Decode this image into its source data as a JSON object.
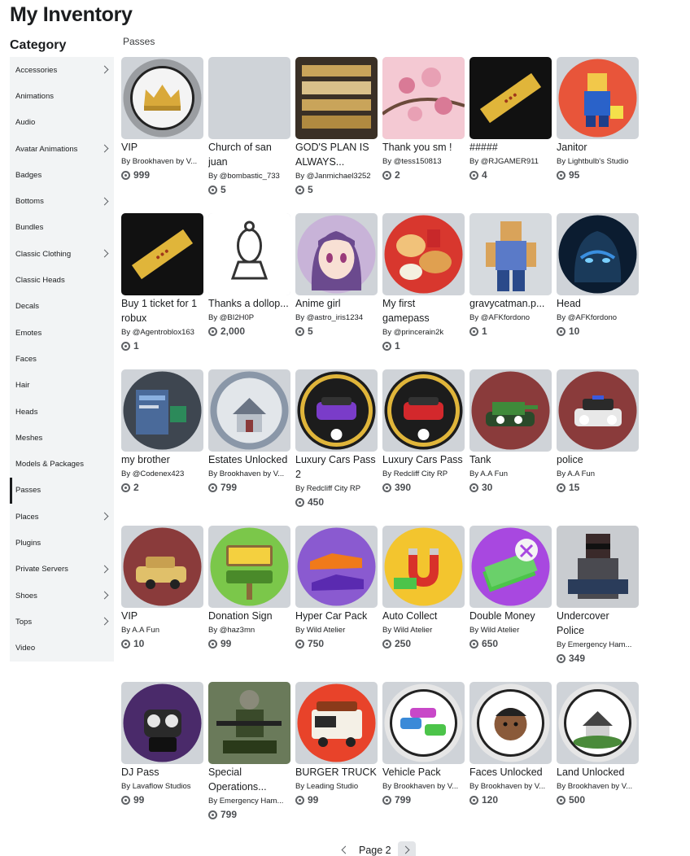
{
  "page": {
    "title": "My Inventory",
    "category_title": "Category",
    "section_label": "Passes"
  },
  "categories": [
    {
      "label": "Accessories",
      "chevron": true
    },
    {
      "label": "Animations",
      "chevron": false
    },
    {
      "label": "Audio",
      "chevron": false
    },
    {
      "label": "Avatar Animations",
      "chevron": true
    },
    {
      "label": "Badges",
      "chevron": false
    },
    {
      "label": "Bottoms",
      "chevron": true
    },
    {
      "label": "Bundles",
      "chevron": false
    },
    {
      "label": "Classic Clothing",
      "chevron": true
    },
    {
      "label": "Classic Heads",
      "chevron": false
    },
    {
      "label": "Decals",
      "chevron": false
    },
    {
      "label": "Emotes",
      "chevron": false
    },
    {
      "label": "Faces",
      "chevron": false
    },
    {
      "label": "Hair",
      "chevron": false
    },
    {
      "label": "Heads",
      "chevron": false
    },
    {
      "label": "Meshes",
      "chevron": false
    },
    {
      "label": "Models & Packages",
      "chevron": false
    },
    {
      "label": "Passes",
      "chevron": false,
      "active": true
    },
    {
      "label": "Places",
      "chevron": true
    },
    {
      "label": "Plugins",
      "chevron": false
    },
    {
      "label": "Private Servers",
      "chevron": true
    },
    {
      "label": "Shoes",
      "chevron": true
    },
    {
      "label": "Tops",
      "chevron": true
    },
    {
      "label": "Video",
      "chevron": false
    }
  ],
  "items": [
    {
      "name": "VIP",
      "creator": "By Brookhaven by V...",
      "price": "999",
      "thumb": "crown-icon",
      "bg": "#9a9da1",
      "fg": "#d9a93a"
    },
    {
      "name": "Church of san juan",
      "creator": "By @bombastic_733",
      "price": "5",
      "thumb": "blank",
      "bg": "#d0d4d9",
      "fg": "#d0d4d9"
    },
    {
      "name": "GOD'S PLAN IS ALWAYS...",
      "creator": "By @Janmichael3252",
      "price": "5",
      "thumb": "text-art-icon",
      "bg": "#3a3026",
      "fg": "#c9a45a"
    },
    {
      "name": "Thank you sm !",
      "creator": "By @tess150813",
      "price": "2",
      "thumb": "blossom-icon",
      "bg": "#f4c9d3",
      "fg": "#d97a96"
    },
    {
      "name": "#####",
      "creator": "By @RJGAMER911",
      "price": "4",
      "thumb": "ticket-icon",
      "bg": "#111111",
      "fg": "#e0b53a"
    },
    {
      "name": "Janitor",
      "creator": "By Lightbulb's Studio",
      "price": "95",
      "thumb": "janitor-icon",
      "bg": "#e8553a",
      "fg": "#2a62c9"
    },
    {
      "name": "Buy 1 ticket for 1 robux",
      "creator": "By @Agentroblox163",
      "price": "1",
      "thumb": "ticket-icon",
      "bg": "#111111",
      "fg": "#e0b53a"
    },
    {
      "name": "Thanks a dollop...",
      "creator": "By @BI2H0P",
      "price": "2,000",
      "thumb": "bishop-icon",
      "bg": "#f4f4f4",
      "fg": "#333333"
    },
    {
      "name": "Anime girl",
      "creator": "By @astro_iris1234",
      "price": "5",
      "thumb": "anime-icon",
      "bg": "#c8b3d8",
      "fg": "#6b4a8e"
    },
    {
      "name": "My first gamepass",
      "creator": "By @princerain2k",
      "price": "1",
      "thumb": "food-icon",
      "bg": "#d8372e",
      "fg": "#f1c27a"
    },
    {
      "name": "gravycatman.p...",
      "creator": "By @AFKfordono",
      "price": "1",
      "thumb": "avatar-icon",
      "bg": "#d6dade",
      "fg": "#d9a35a"
    },
    {
      "name": "Head",
      "creator": "By @AFKfordono",
      "price": "10",
      "thumb": "head-icon",
      "bg": "#0b1c30",
      "fg": "#3a8fe0"
    },
    {
      "name": "my brother",
      "creator": "By @Codenex423",
      "price": "2",
      "thumb": "screenshot-icon",
      "bg": "#3e4650",
      "fg": "#2c8a5a"
    },
    {
      "name": "Estates Unlocked",
      "creator": "By Brookhaven by V...",
      "price": "799",
      "thumb": "house-icon",
      "bg": "#8a97a8",
      "fg": "#e2e6ea"
    },
    {
      "name": "Luxury Cars Pass 2",
      "creator": "By Redcliff City RP",
      "price": "450",
      "thumb": "car-purple-icon",
      "bg": "#1c1c1c",
      "fg": "#7a3cc9"
    },
    {
      "name": "Luxury Cars Pass",
      "creator": "By Redcliff City RP",
      "price": "390",
      "thumb": "car-red-icon",
      "bg": "#1c1c1c",
      "fg": "#d3282c"
    },
    {
      "name": "Tank",
      "creator": "By A.A Fun",
      "price": "30",
      "thumb": "tank-icon",
      "bg": "#8a3b3b",
      "fg": "#3f8a3a"
    },
    {
      "name": "police",
      "creator": "By A.A Fun",
      "price": "15",
      "thumb": "police-car-icon",
      "bg": "#8a3b3b",
      "fg": "#e8e8e8"
    },
    {
      "name": "VIP",
      "creator": "By A.A Fun",
      "price": "10",
      "thumb": "car-gold-icon",
      "bg": "#8a3b3b",
      "fg": "#e0c06a"
    },
    {
      "name": "Donation Sign",
      "creator": "By @haz3mn",
      "price": "99",
      "thumb": "sign-icon",
      "bg": "#7bc74a",
      "fg": "#f4d03f"
    },
    {
      "name": "Hyper Car Pack",
      "creator": "By Wild Atelier",
      "price": "750",
      "thumb": "hypercar-icon",
      "bg": "#8a5ad0",
      "fg": "#f07a1a"
    },
    {
      "name": "Auto Collect",
      "creator": "By Wild Atelier",
      "price": "250",
      "thumb": "magnet-icon",
      "bg": "#f3c52e",
      "fg": "#d8322a"
    },
    {
      "name": "Double Money",
      "creator": "By Wild Atelier",
      "price": "650",
      "thumb": "money-x2-icon",
      "bg": "#a848e0",
      "fg": "#4cc44a"
    },
    {
      "name": "Undercover Police",
      "creator": "By Emergency Ham...",
      "price": "349",
      "thumb": "undercover-icon",
      "bg": "#c9ccd0",
      "fg": "#2a3c5a"
    },
    {
      "name": "DJ Pass",
      "creator": "By Lavaflow Studios",
      "price": "99",
      "thumb": "dj-icon",
      "bg": "#4a2a6a",
      "fg": "#8a5ad0"
    },
    {
      "name": "Special Operations...",
      "creator": "By Emergency Ham...",
      "price": "799",
      "thumb": "soldier-icon",
      "bg": "#6a7a5a",
      "fg": "#3a4a2a"
    },
    {
      "name": "BURGER TRUCK",
      "creator": "By Leading Studio",
      "price": "99",
      "thumb": "truck-icon",
      "bg": "#e8432a",
      "fg": "#f4f0e6"
    },
    {
      "name": "Vehicle Pack",
      "creator": "By Brookhaven by V...",
      "price": "799",
      "thumb": "vehicle-pack-icon",
      "bg": "#e6e6e6",
      "fg": "#3a8ad8"
    },
    {
      "name": "Faces Unlocked",
      "creator": "By Brookhaven by V...",
      "price": "120",
      "thumb": "face-icon",
      "bg": "#e6e6e6",
      "fg": "#8a5a3a"
    },
    {
      "name": "Land Unlocked",
      "creator": "By Brookhaven by V...",
      "price": "500",
      "thumb": "land-icon",
      "bg": "#e6e6e6",
      "fg": "#4a8a3a"
    }
  ],
  "pagination": {
    "label": "Page 2"
  }
}
